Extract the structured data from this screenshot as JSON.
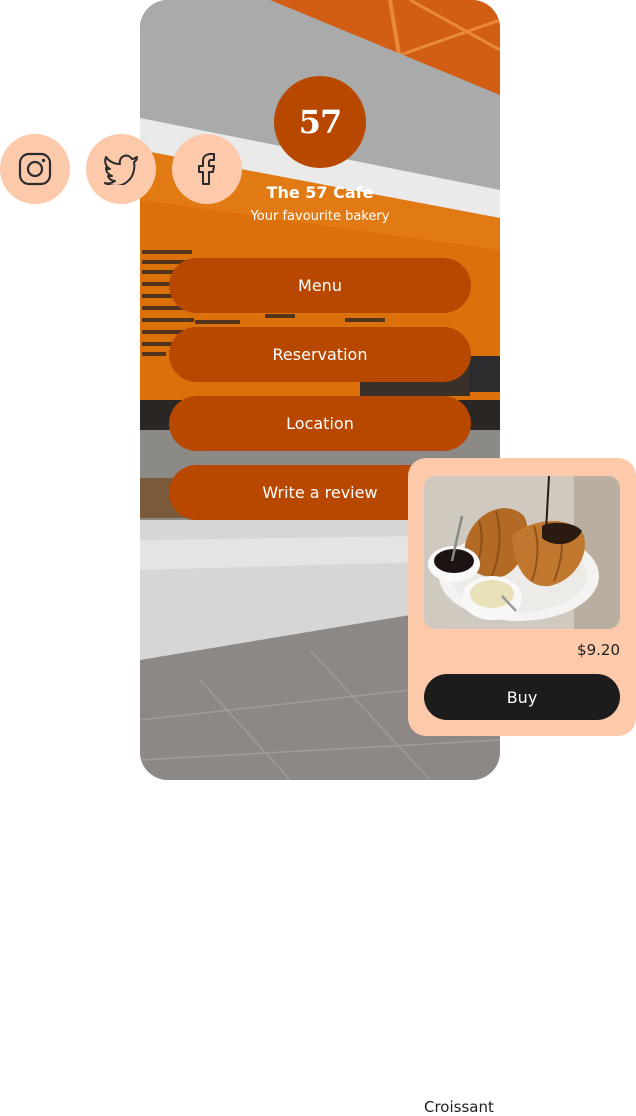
{
  "profile": {
    "logo_text": "57",
    "name": "The 57 Cafe",
    "tagline": "Your favourite bakery"
  },
  "links": [
    {
      "label": "Menu"
    },
    {
      "label": "Reservation"
    },
    {
      "label": "Location"
    },
    {
      "label": "Write a review"
    }
  ],
  "socials": [
    {
      "icon": "instagram-icon"
    },
    {
      "icon": "twitter-icon"
    },
    {
      "icon": "facebook-icon"
    }
  ],
  "product": {
    "name": "Croissant",
    "price": "$9.20",
    "buy_label": "Buy"
  },
  "colors": {
    "accent": "#b84700",
    "peach": "#fcc9ab",
    "dark": "#1c1c1c"
  }
}
